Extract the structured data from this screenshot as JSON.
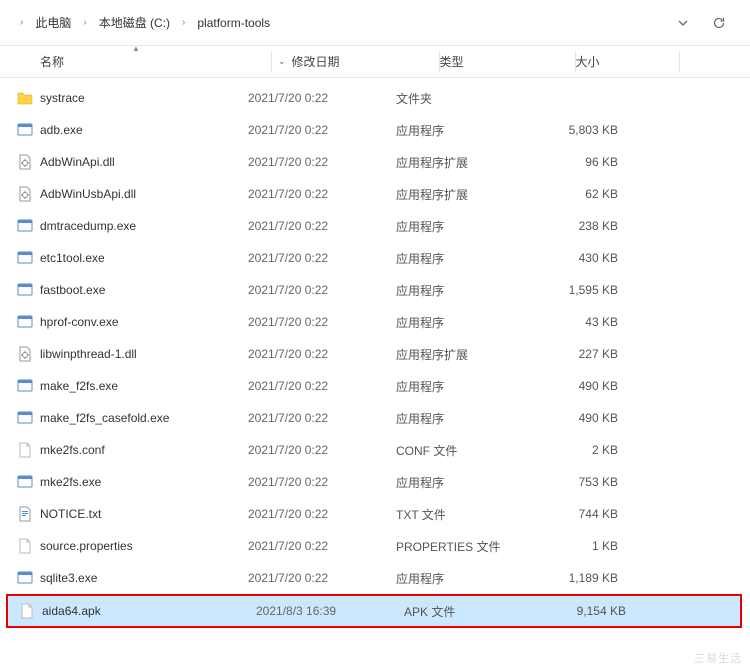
{
  "breadcrumb": [
    {
      "label": "此电脑"
    },
    {
      "label": "本地磁盘 (C:)"
    },
    {
      "label": "platform-tools"
    }
  ],
  "columns": {
    "name": "名称",
    "date": "修改日期",
    "type": "类型",
    "size": "大小"
  },
  "files": [
    {
      "icon": "folder",
      "name": "systrace",
      "date": "2021/7/20 0:22",
      "type": "文件夹",
      "size": ""
    },
    {
      "icon": "exe",
      "name": "adb.exe",
      "date": "2021/7/20 0:22",
      "type": "应用程序",
      "size": "5,803 KB"
    },
    {
      "icon": "dll",
      "name": "AdbWinApi.dll",
      "date": "2021/7/20 0:22",
      "type": "应用程序扩展",
      "size": "96 KB"
    },
    {
      "icon": "dll",
      "name": "AdbWinUsbApi.dll",
      "date": "2021/7/20 0:22",
      "type": "应用程序扩展",
      "size": "62 KB"
    },
    {
      "icon": "exe",
      "name": "dmtracedump.exe",
      "date": "2021/7/20 0:22",
      "type": "应用程序",
      "size": "238 KB"
    },
    {
      "icon": "exe",
      "name": "etc1tool.exe",
      "date": "2021/7/20 0:22",
      "type": "应用程序",
      "size": "430 KB"
    },
    {
      "icon": "exe",
      "name": "fastboot.exe",
      "date": "2021/7/20 0:22",
      "type": "应用程序",
      "size": "1,595 KB"
    },
    {
      "icon": "exe",
      "name": "hprof-conv.exe",
      "date": "2021/7/20 0:22",
      "type": "应用程序",
      "size": "43 KB"
    },
    {
      "icon": "dll",
      "name": "libwinpthread-1.dll",
      "date": "2021/7/20 0:22",
      "type": "应用程序扩展",
      "size": "227 KB"
    },
    {
      "icon": "exe",
      "name": "make_f2fs.exe",
      "date": "2021/7/20 0:22",
      "type": "应用程序",
      "size": "490 KB"
    },
    {
      "icon": "exe",
      "name": "make_f2fs_casefold.exe",
      "date": "2021/7/20 0:22",
      "type": "应用程序",
      "size": "490 KB"
    },
    {
      "icon": "file",
      "name": "mke2fs.conf",
      "date": "2021/7/20 0:22",
      "type": "CONF 文件",
      "size": "2 KB"
    },
    {
      "icon": "exe",
      "name": "mke2fs.exe",
      "date": "2021/7/20 0:22",
      "type": "应用程序",
      "size": "753 KB"
    },
    {
      "icon": "txt",
      "name": "NOTICE.txt",
      "date": "2021/7/20 0:22",
      "type": "TXT 文件",
      "size": "744 KB"
    },
    {
      "icon": "file",
      "name": "source.properties",
      "date": "2021/7/20 0:22",
      "type": "PROPERTIES 文件",
      "size": "1 KB"
    },
    {
      "icon": "exe",
      "name": "sqlite3.exe",
      "date": "2021/7/20 0:22",
      "type": "应用程序",
      "size": "1,189 KB"
    },
    {
      "icon": "file",
      "name": "aida64.apk",
      "date": "2021/8/3 16:39",
      "type": "APK 文件",
      "size": "9,154 KB",
      "selected": true
    }
  ],
  "icons": {
    "folder": "folder-icon",
    "exe": "exe-icon",
    "dll": "dll-icon",
    "file": "file-icon",
    "txt": "txt-icon"
  }
}
